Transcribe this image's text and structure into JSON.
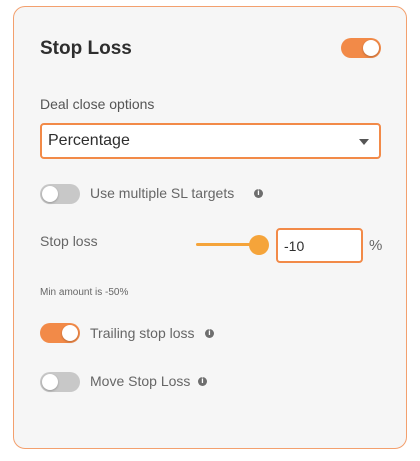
{
  "panel": {
    "title": "Stop Loss",
    "enabled": true
  },
  "deal_close": {
    "label": "Deal close options",
    "selected": "Percentage"
  },
  "multiple_sl": {
    "label": "Use multiple SL targets",
    "enabled": false,
    "info_icon": "i"
  },
  "stop_loss": {
    "label": "Stop loss",
    "value": "-10",
    "unit": "%",
    "slider_fraction": 0.8,
    "hint": "Min amount is -50%"
  },
  "trailing": {
    "label": "Trailing stop loss",
    "enabled": true,
    "info_icon": "i"
  },
  "move_sl": {
    "label": "Move Stop Loss",
    "enabled": false,
    "info_icon": "i"
  },
  "colors": {
    "accent": "#f28a48",
    "slider": "#f5a43a",
    "toggle_off": "#c8c8c8"
  }
}
